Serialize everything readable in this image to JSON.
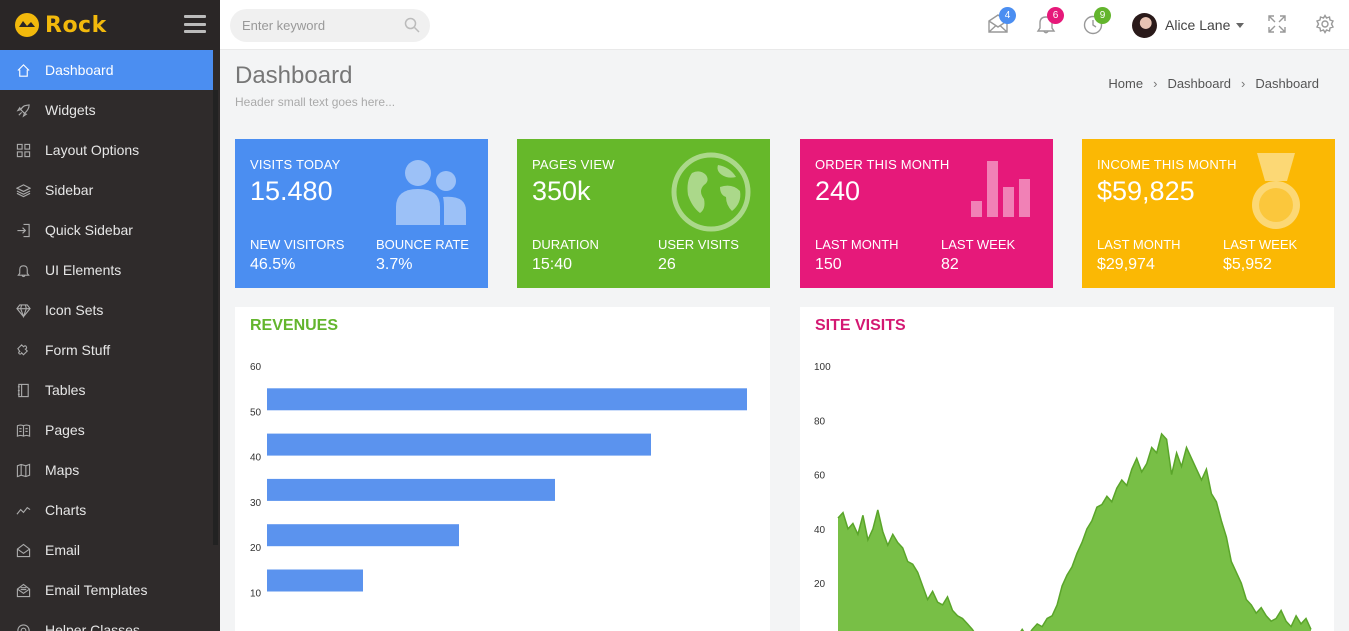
{
  "app": {
    "name": "Rock"
  },
  "search": {
    "placeholder": "Enter keyword"
  },
  "topbar": {
    "messages_count": "4",
    "notifications_count": "6",
    "tasks_count": "9",
    "user_name": "Alice Lane",
    "colors": {
      "messages": "#4b8ef1",
      "notifications": "#e6197a",
      "tasks": "#63b52d"
    }
  },
  "sidebar": {
    "items": [
      {
        "label": "Dashboard",
        "icon": "home-icon"
      },
      {
        "label": "Widgets",
        "icon": "rocket-icon"
      },
      {
        "label": "Layout Options",
        "icon": "grid-icon"
      },
      {
        "label": "Sidebar",
        "icon": "layers-icon"
      },
      {
        "label": "Quick Sidebar",
        "icon": "login-icon"
      },
      {
        "label": "UI Elements",
        "icon": "bell-icon"
      },
      {
        "label": "Icon Sets",
        "icon": "diamond-icon"
      },
      {
        "label": "Form Stuff",
        "icon": "puzzle-icon"
      },
      {
        "label": "Tables",
        "icon": "notebook-icon"
      },
      {
        "label": "Pages",
        "icon": "book-icon"
      },
      {
        "label": "Maps",
        "icon": "map-icon"
      },
      {
        "label": "Charts",
        "icon": "chart-line-icon"
      },
      {
        "label": "Email",
        "icon": "envelope-open-icon"
      },
      {
        "label": "Email Templates",
        "icon": "envelope-letter-icon"
      },
      {
        "label": "Helper Classes",
        "icon": "helper-icon"
      }
    ]
  },
  "page": {
    "title": "Dashboard",
    "subtitle": "Header small text goes here...",
    "breadcrumb": [
      "Home",
      "Dashboard",
      "Dashboard"
    ]
  },
  "stats": [
    {
      "title": "VISITS TODAY",
      "value": "15.480",
      "label1": "NEW VISITORS",
      "value1": "46.5%",
      "label2": "BOUNCE RATE",
      "value2": "3.7%",
      "color": "#4b8ef1",
      "icon": "users-icon"
    },
    {
      "title": "PAGES VIEW",
      "value": "350k",
      "label1": "DURATION",
      "value1": "15:40",
      "label2": "USER VISITS",
      "value2": "26",
      "color": "#66b82a",
      "icon": "globe-icon"
    },
    {
      "title": "ORDER THIS MONTH",
      "value": "240",
      "label1": "LAST MONTH",
      "value1": "150",
      "label2": "LAST WEEK",
      "value2": "82",
      "color": "#e6197a",
      "icon": "bar-chart-icon"
    },
    {
      "title": "INCOME THIS MONTH",
      "value": "$59,825",
      "label1": "LAST MONTH",
      "value1": "$29,974",
      "label2": "LAST WEEK",
      "value2": "$5,952",
      "color": "#fbb804",
      "icon": "medal-icon"
    }
  ],
  "panels": {
    "revenues": {
      "title": "REVENUES",
      "color": "#63b52d"
    },
    "site_visits": {
      "title": "SITE VISITS",
      "color": "#d41872"
    }
  },
  "chart_data": [
    {
      "type": "bar",
      "orientation": "horizontal",
      "title": "REVENUES",
      "ticks": [
        60,
        50,
        40,
        30,
        20,
        10
      ],
      "values": [
        50,
        40,
        30,
        20,
        10
      ],
      "color": "#5b93ee"
    },
    {
      "type": "area",
      "title": "SITE VISITS",
      "ticks": [
        100,
        80,
        60,
        40,
        20
      ],
      "ylim": [
        0,
        100
      ],
      "color": "#78bf46",
      "values": [
        44,
        46,
        40,
        42,
        38,
        45,
        36,
        40,
        47,
        39,
        34,
        38,
        35,
        33,
        28,
        27,
        24,
        19,
        14,
        17,
        13,
        12,
        15,
        10,
        8,
        7,
        5,
        3,
        0,
        -2,
        1,
        -4,
        -3,
        0,
        2,
        -3,
        0,
        3,
        -1,
        3,
        5,
        4,
        7,
        8,
        12,
        19,
        23,
        26,
        31,
        35,
        40,
        43,
        48,
        49,
        52,
        50,
        55,
        58,
        56,
        62,
        66,
        61,
        64,
        70,
        68,
        75,
        73,
        60,
        68,
        63,
        70,
        66,
        62,
        58,
        62,
        53,
        50,
        43,
        37,
        28,
        24,
        20,
        14,
        12,
        9,
        11,
        8,
        6,
        7,
        10,
        6,
        4,
        8,
        5,
        7,
        3
      ]
    }
  ]
}
